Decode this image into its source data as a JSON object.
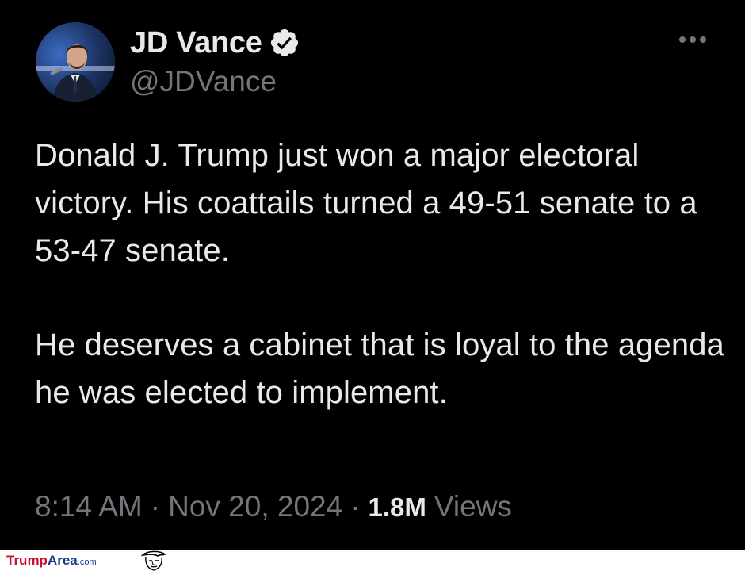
{
  "tweet": {
    "author": {
      "display_name": "JD Vance",
      "handle": "@JDVance",
      "verified": true,
      "avatar_icon": "profile-photo"
    },
    "more_icon": "more-options-icon",
    "paragraphs": [
      "Donald J. Trump just won a major electoral victory. His coattails turned a 49-51 senate to a 53-47 senate.",
      "He deserves a cabinet that is loyal to the agenda he was elected to implement."
    ],
    "time": "8:14 AM",
    "separator": "·",
    "date": "Nov 20, 2024",
    "views_count": "1.8M",
    "views_label": "Views"
  },
  "watermark": {
    "part1": "Trump",
    "part2": "Area",
    "part3": ".com"
  },
  "colors": {
    "background": "#000000",
    "text_primary": "#e7e9ea",
    "text_secondary": "#71767b",
    "verified_badge": "#1d9bf0"
  }
}
